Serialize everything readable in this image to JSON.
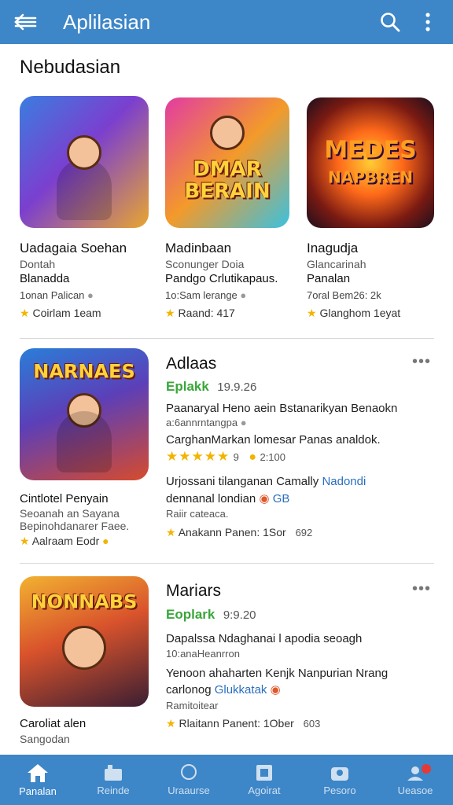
{
  "header": {
    "title": "Aplilasian",
    "back_icon": "back-arrow-icon",
    "search_icon": "search-icon",
    "menu_icon": "more-vert-icon",
    "bg": "#3d86c8"
  },
  "section": {
    "title": "Nebudasian"
  },
  "top_apps": [
    {
      "name": "Uadagaia Soehan",
      "dev": "Dontah",
      "category": "Blanadda",
      "meta": "1onan Palican",
      "rating": "Coirlam 1eam"
    },
    {
      "name": "Madinbaan",
      "dev": "Sconunger Doia",
      "category": "Pandgo Crlutikapaus.",
      "meta": "1o:Sam lerange",
      "rating": "Raand:  417",
      "art": "DMAR\nBERAIN"
    },
    {
      "name": "Inagudja",
      "dev": "Glancarinah",
      "category": "Panalan",
      "meta": "7oral Bem26: 2k",
      "rating": "Glanghom 1eyat",
      "art": "MEDES\nNAPBREN"
    }
  ],
  "list_apps": [
    {
      "art": "NARNAES",
      "left_title": "Cintlotel Penyain",
      "left_sub": "Seoanah an Sayana",
      "left_sub2": "Bepinohdanarer Faee.",
      "left_rating": "Aalraam Eodr",
      "title": "Adlaas",
      "badge": "Eplakk",
      "version": "19.9.26",
      "desc1": "Paanaryal Heno aein Bstanarikyan Benaokn",
      "desc2": "a:6annrntangpa",
      "desc3": "CarghanMarkan lomesar Panas analdok.",
      "stars": "★★★★★",
      "rating_count": "9",
      "downloads": "2:100",
      "extra1": "Urjossani tilanganan Camally",
      "extra1_link": "Nadondi",
      "extra2": "dennanal londian",
      "extra2_link": "GB",
      "extra3": "Raiir cateaca.",
      "footer": "Anakann Panen: 1Sor",
      "footer_extra": "692"
    },
    {
      "art": "NONNABS",
      "left_title": "Caroliat alen",
      "left_sub": "Sangodan",
      "title": "Mariars",
      "badge": "Eoplark",
      "version": "9:9.20",
      "desc1": "Dapalssa Ndaghanai l apodia seoagh",
      "desc2": "10:anaHeanrron",
      "desc3": "Yenoon ahaharten Kenjk Nanpurian Nrang",
      "extra1": "carlonog",
      "extra1_link": "Glukkatak",
      "extra2": "Ramitoitear",
      "footer": "Rlaitann Panent: 1Ober",
      "footer_extra": "603"
    }
  ],
  "bottom_nav": [
    {
      "label": "Panalan",
      "icon": "home-icon",
      "active": true
    },
    {
      "label": "Reinde",
      "icon": "games-icon",
      "active": false
    },
    {
      "label": "Uraaurse",
      "icon": "apps-icon",
      "active": false
    },
    {
      "label": "Agoirat",
      "icon": "book-icon",
      "active": false
    },
    {
      "label": "Pesoro",
      "icon": "account-icon",
      "active": false
    },
    {
      "label": "Ueasoe",
      "icon": "notification-icon",
      "active": false
    }
  ]
}
